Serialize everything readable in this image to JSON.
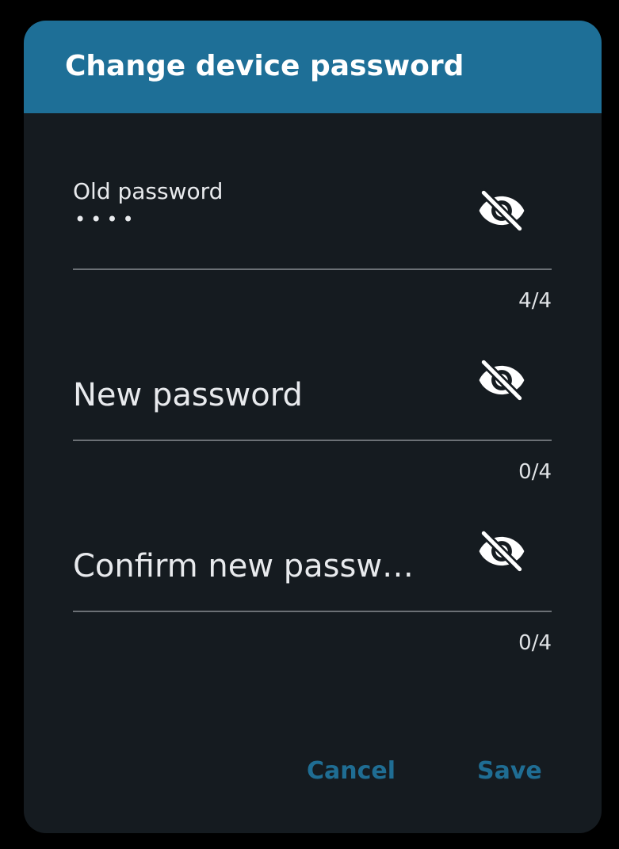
{
  "dialog": {
    "title": "Change device password",
    "colors": {
      "header": "#1e6f97",
      "surface": "#151b20",
      "accent": "#1f6d93",
      "text": "#e8eaed",
      "underline": "#6b7075"
    },
    "fields": {
      "old_password": {
        "label": "Old password",
        "value": "••••",
        "counter": "4/4",
        "toggle_icon": "visibility-off-icon"
      },
      "new_password": {
        "label": "New password",
        "value": "",
        "counter": "0/4",
        "toggle_icon": "visibility-off-icon"
      },
      "confirm_password": {
        "label": "Confirm new passw…",
        "value": "",
        "counter": "0/4",
        "toggle_icon": "visibility-off-icon"
      }
    },
    "actions": {
      "cancel_label": "Cancel",
      "save_label": "Save"
    }
  }
}
